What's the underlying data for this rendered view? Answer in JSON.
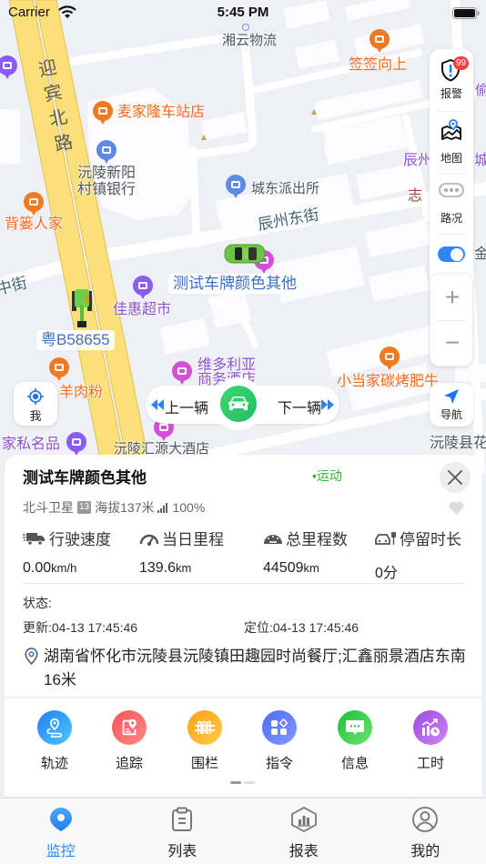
{
  "status_bar": {
    "carrier": "Carrier",
    "time": "5:45 PM",
    "icons": [
      "wifi-icon",
      "battery-icon"
    ]
  },
  "map": {
    "road_labels": {
      "main_road": "迎宾北路",
      "east_street": "辰州东街",
      "middle_street": "中街"
    },
    "pois": {
      "logistics": "湘云物流",
      "qianqian": "签签向上",
      "maijialong": "麦家隆车站店",
      "bank_line1": "沅陵新阳",
      "bank_line2": "村镇银行",
      "police": "城东派出所",
      "beilou": "背篓人家",
      "jiahui": "佳惠超市",
      "hotel_line1": "维多利亚",
      "hotel_line2": "商务酒店",
      "xiaodangjia": "小当家碳烤肥牛",
      "yangroufen": "羊肉粉",
      "jiasi": "家私名品",
      "huiyuan": "沅陵汇源大酒店",
      "huayuan_partial": "沅陵县花",
      "chenzhou_partial": "辰州",
      "cheng_partial": "城",
      "zhi_partial": "志",
      "jin_partial": "金",
      "tou_partial": "偷"
    },
    "poi_colors": {
      "food": "#f07a21",
      "shopping": "#8a5cf0",
      "hotel": "#d24fd8",
      "public": "#5b8be6"
    },
    "vehicles": [
      {
        "plate": "测试车牌颜色其他",
        "type": "car"
      },
      {
        "plate": "粤B58655",
        "type": "excavator"
      }
    ]
  },
  "map_controls": {
    "alarm": {
      "label": "报警",
      "badge": "99"
    },
    "map_type_label": "地图",
    "traffic_label": "路况",
    "layer_toggle_on": true,
    "zoom_in": "+",
    "zoom_out": "−",
    "navigate_label": "导航",
    "locate_me_label": "我"
  },
  "vehicle_switcher": {
    "prev_label": "上一辆",
    "next_label": "下一辆"
  },
  "vehicle_panel": {
    "plate": "测试车牌颜色其他",
    "status": "•运动",
    "status_color": "#2cbb2c",
    "satellite_label": "北斗卫星",
    "satellite_count": "13",
    "altitude": "海拔137米",
    "signal": "100%",
    "favorite": false,
    "stats": [
      {
        "icon": "truck-icon",
        "label": "行驶速度",
        "value": "0.00",
        "unit": "km/h"
      },
      {
        "icon": "speedometer-icon",
        "label": "当日里程",
        "value": "139.6",
        "unit": "km"
      },
      {
        "icon": "odometer-icon",
        "label": "总里程数",
        "value": "44509",
        "unit": "km"
      },
      {
        "icon": "parked-car-icon",
        "label": "停留时长",
        "value": "0",
        "unit": "分"
      }
    ],
    "status_label": "状态:",
    "updated": "更新:04-13 17:45:46",
    "located": "定位:04-13 17:45:46",
    "address": "湖南省怀化市沅陵县沅陵镇田趣园时尚餐厅;汇鑫丽景酒店东南16米",
    "actions": [
      {
        "label": "轨迹",
        "icon": "track-icon",
        "colors": [
          "#1f7ef5",
          "#52c6ff"
        ]
      },
      {
        "label": "追踪",
        "icon": "trace-icon",
        "colors": [
          "#f5525b",
          "#ff8a84"
        ]
      },
      {
        "label": "围栏",
        "icon": "fence-icon",
        "colors": [
          "#ffa01a",
          "#ffcc45"
        ]
      },
      {
        "label": "指令",
        "icon": "command-icon",
        "colors": [
          "#4d6bf6",
          "#8399ff"
        ]
      },
      {
        "label": "信息",
        "icon": "message-icon",
        "colors": [
          "#18c236",
          "#72e272"
        ]
      },
      {
        "label": "工时",
        "icon": "work-hours-icon",
        "colors": [
          "#9a4ce0",
          "#cf83f2"
        ]
      }
    ],
    "page_indicator": {
      "current": 1,
      "total": 2
    }
  },
  "tab_bar": {
    "active_color": "#2a8cf3",
    "tabs": [
      {
        "label": "监控",
        "icon": "monitor-pin-icon",
        "active": true
      },
      {
        "label": "列表",
        "icon": "clipboard-list-icon",
        "active": false
      },
      {
        "label": "报表",
        "icon": "report-chart-icon",
        "active": false
      },
      {
        "label": "我的",
        "icon": "user-icon",
        "active": false
      }
    ]
  }
}
